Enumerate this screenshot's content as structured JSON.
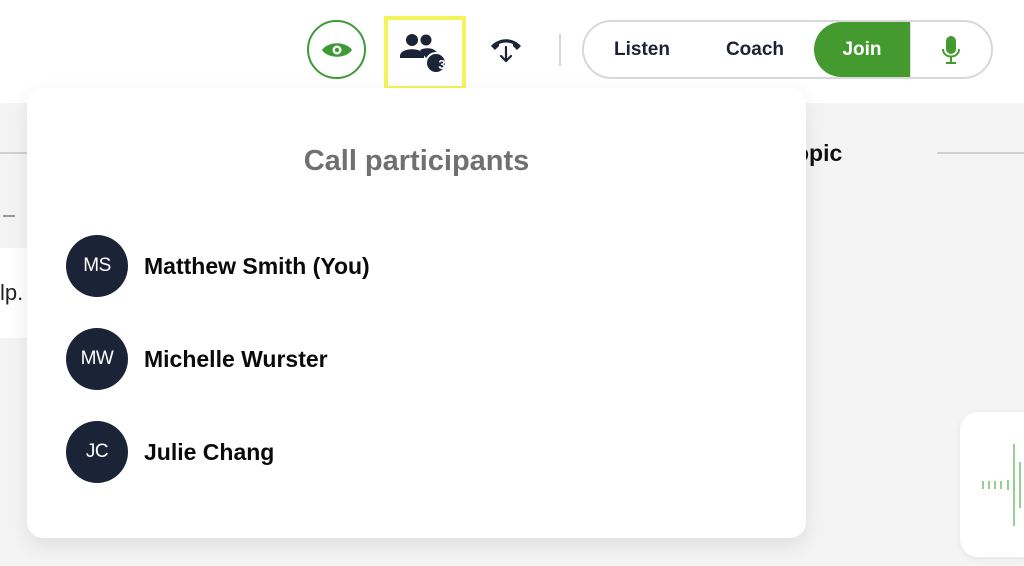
{
  "toolbar": {
    "eye_icon": "eye-icon",
    "participants_icon": "participants-icon",
    "participants_count": "3",
    "hangup_icon": "phone-hangup-transfer-icon",
    "modes": {
      "listen": "Listen",
      "coach": "Coach",
      "join": "Join",
      "active": "Join"
    },
    "mic_icon": "microphone-icon"
  },
  "background": {
    "topic_heading": "opic",
    "left_text": "lp."
  },
  "popover": {
    "title": "Call participants",
    "participants": [
      {
        "initials": "MS",
        "name": "Matthew Smith (You)"
      },
      {
        "initials": "MW",
        "name": "Michelle Wurster"
      },
      {
        "initials": "JC",
        "name": "Julie Chang"
      }
    ]
  },
  "colors": {
    "accent_green": "#449a2f",
    "avatar_bg": "#1b2336",
    "highlight_yellow": "#f3f35a"
  }
}
